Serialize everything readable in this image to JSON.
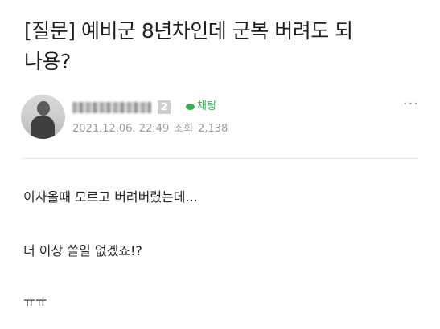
{
  "post": {
    "title_line1": "[질문] 예비군 8년차인데 군복 버려도 되",
    "title_line2": "나용?"
  },
  "author": {
    "level": "2",
    "chat_label": "채팅",
    "date": "2021.12.06. 22:49",
    "views_label": "조회",
    "views": "2,138",
    "more": "···"
  },
  "body": {
    "line1": "이사올때 모르고 버려버렸는데...",
    "line2": "더 이상 쓸일 없겠죠!?",
    "line3": "ㅠㅠ"
  },
  "icons": {
    "chat": "chat-bubble-icon",
    "more": "more-options-icon"
  },
  "colors": {
    "chat_green": "#2ab84e",
    "meta_gray": "#9a9a9a"
  }
}
